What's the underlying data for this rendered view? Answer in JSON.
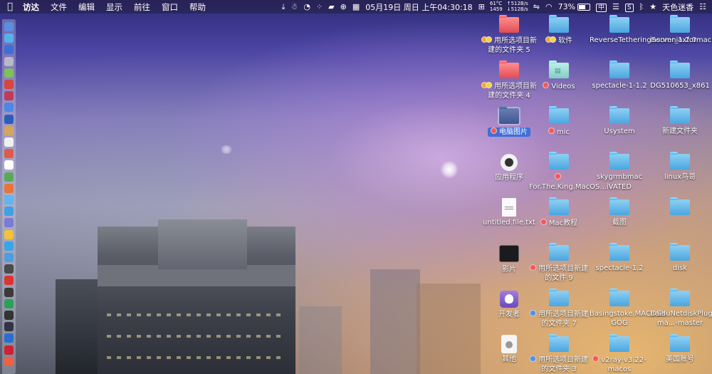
{
  "menubar": {
    "app_name": "访达",
    "menus": [
      "文件",
      "编辑",
      "显示",
      "前往",
      "窗口",
      "帮助"
    ],
    "net_left_top": "61°C",
    "net_left_bottom": "1459",
    "net_up": "↑512B/s",
    "net_down": "↓512B/s",
    "datetime": "05月19日 周日 上午04:30:18",
    "battery": "73%",
    "battery_level": 0.73,
    "input_method": "中",
    "user_name": "天色迷香",
    "s_badge": "S"
  },
  "desktop": {
    "icons": [
      {
        "label": "用所选项目新建的文件夹 5",
        "kind": "folder-red",
        "tags": [
          "orange",
          "yellow"
        ]
      },
      {
        "label": "软件",
        "kind": "folder-blue",
        "tags": [
          "orange",
          "yellow"
        ]
      },
      {
        "label": "ReverseTetheringServer_1.2.0",
        "kind": "folder-blue",
        "tags": []
      },
      {
        "label": "insomniaxformacHHB_jb51",
        "kind": "folder-blue",
        "tags": []
      },
      {
        "label": "用所选项目新建的文件夹 4",
        "kind": "folder-red",
        "tags": [
          "orange",
          "yellow"
        ]
      },
      {
        "label": "Videos",
        "kind": "folder-teal",
        "tags": [
          "red"
        ]
      },
      {
        "label": "spectacle-1-1.2",
        "kind": "folder-blue",
        "tags": []
      },
      {
        "label": "DG510653_x861",
        "kind": "folder-blue",
        "tags": []
      },
      {
        "label": "电脑图片",
        "kind": "folder-dark",
        "tags": [
          "red"
        ]
      },
      {
        "label": "mic",
        "kind": "folder-blue",
        "tags": [
          "red"
        ]
      },
      {
        "label": "Usystem",
        "kind": "folder-blue",
        "tags": []
      },
      {
        "label": "新建文件夹",
        "kind": "folder-blue",
        "tags": []
      },
      {
        "label": "应用程序",
        "kind": "app-round",
        "tags": []
      },
      {
        "label": "For.The.King.MacOS...iVATED",
        "kind": "folder-blue",
        "tags": [
          "red"
        ]
      },
      {
        "label": "skygrmbmac",
        "kind": "folder-blue",
        "tags": []
      },
      {
        "label": "linux鸟哥",
        "kind": "folder-blue",
        "tags": []
      },
      {
        "label": "untitled file.txt",
        "kind": "doc",
        "tags": []
      },
      {
        "label": "Mac教程",
        "kind": "folder-blue",
        "tags": [
          "red"
        ]
      },
      {
        "label": "截图",
        "kind": "folder-blue",
        "tags": []
      },
      {
        "label": "",
        "kind": "folder-blue",
        "tags": []
      },
      {
        "label": "影片",
        "kind": "app-movie",
        "tags": []
      },
      {
        "label": "用所选项目新建的文件 9",
        "kind": "folder-blue",
        "tags": [
          "red"
        ]
      },
      {
        "label": "spectacle-1.2",
        "kind": "folder-blue",
        "tags": []
      },
      {
        "label": "disk",
        "kind": "folder-blue",
        "tags": []
      },
      {
        "label": "开发者",
        "kind": "app-dev",
        "tags": []
      },
      {
        "label": "用所选项目新建的文件夹 7",
        "kind": "folder-blue",
        "tags": [
          "blue"
        ]
      },
      {
        "label": "Basingstoke.MACOSX-GOG",
        "kind": "folder-blue",
        "tags": []
      },
      {
        "label": "BaiduNetdiskPlugin-ma...-master",
        "kind": "folder-blue",
        "tags": []
      },
      {
        "label": "其他",
        "kind": "app-other",
        "tags": []
      },
      {
        "label": "用所选项目新建的文件夹 3",
        "kind": "folder-blue",
        "tags": [
          "blue"
        ]
      },
      {
        "label": "v2ray-v3.22-macos",
        "kind": "folder-blue",
        "tags": [
          "red"
        ]
      },
      {
        "label": "美国账号",
        "kind": "folder-blue",
        "tags": []
      }
    ]
  },
  "dock_icon_colors": [
    "#5b8de0",
    "#55b0ee",
    "#3c6fd8",
    "#b8b8c8",
    "#7fc05a",
    "#d9453f",
    "#c23a5a",
    "#4e86e8",
    "#2a5fb8",
    "#d7a55a",
    "#f0f0f0",
    "#e05a4a",
    "#ffffff",
    "#5aa85a",
    "#e8743a",
    "#5fb6f0",
    "#3fa0e8",
    "#7a7ad8",
    "#f2c33a",
    "#3aa4e8",
    "#4e9de0",
    "#4a4a4a",
    "#dd3333",
    "#3a3a3a",
    "#2aa05a",
    "#333333",
    "#333344",
    "#2a6fd0",
    "#cc2233",
    "#f06040"
  ]
}
